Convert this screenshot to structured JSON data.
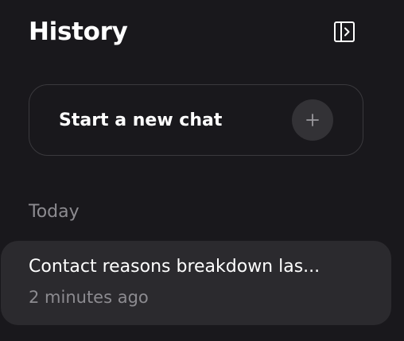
{
  "header": {
    "title": "History",
    "collapse_icon": "sidebar-panel-icon"
  },
  "new_chat": {
    "label": "Start a new chat",
    "icon": "plus-icon"
  },
  "sections": [
    {
      "label": "Today",
      "items": [
        {
          "title": "Contact reasons breakdown las...",
          "time": "2 minutes ago"
        }
      ]
    }
  ],
  "colors": {
    "background": "#19181c",
    "card_border": "#3a393d",
    "item_background": "#2b2a2e",
    "muted_text": "#8c8b90",
    "plus_circle": "#333236"
  }
}
